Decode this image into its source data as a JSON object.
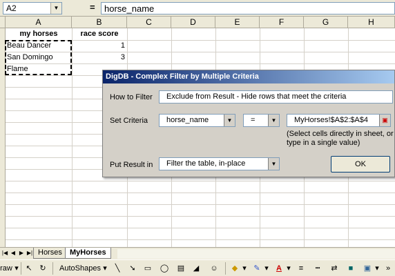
{
  "formula_bar": {
    "name_box": "A2",
    "equals": "=",
    "formula": "horse_name"
  },
  "columns": [
    "A",
    "B",
    "C",
    "D",
    "E",
    "F",
    "G",
    "H"
  ],
  "cells": {
    "a1": "my horses",
    "b1": "race score",
    "a2": "Beau Dancer",
    "b2": "1",
    "a3": "San Domingo",
    "b3": "3",
    "a4": "Flame"
  },
  "dialog": {
    "title": "DigDB - Complex Filter by Multiple Criteria",
    "how_to_filter_label": "How to Filter",
    "how_to_filter_value": "Exclude from Result  - Hide rows that meet the criteria",
    "set_criteria_label": "Set Criteria",
    "criteria_field": "horse_name",
    "criteria_operator": "=",
    "criteria_ref": "MyHorses!$A$2:$A$4",
    "criteria_note": "(Select cells directly in sheet, or type in a single value)",
    "put_result_label": "Put Result in",
    "put_result_value": "Filter the table, in-place",
    "ok_label": "OK"
  },
  "sheet_tabs": [
    "Horses",
    "MyHorses"
  ],
  "active_tab": "MyHorses",
  "toolbar": {
    "draw_label": "raw",
    "autoshapes_label": "AutoShapes"
  },
  "colors": {
    "title_bar_start": "#0a246a",
    "title_bar_end": "#a6caf0",
    "font_color_red": "#cc0000",
    "fill_yellow": "#ffff00"
  }
}
